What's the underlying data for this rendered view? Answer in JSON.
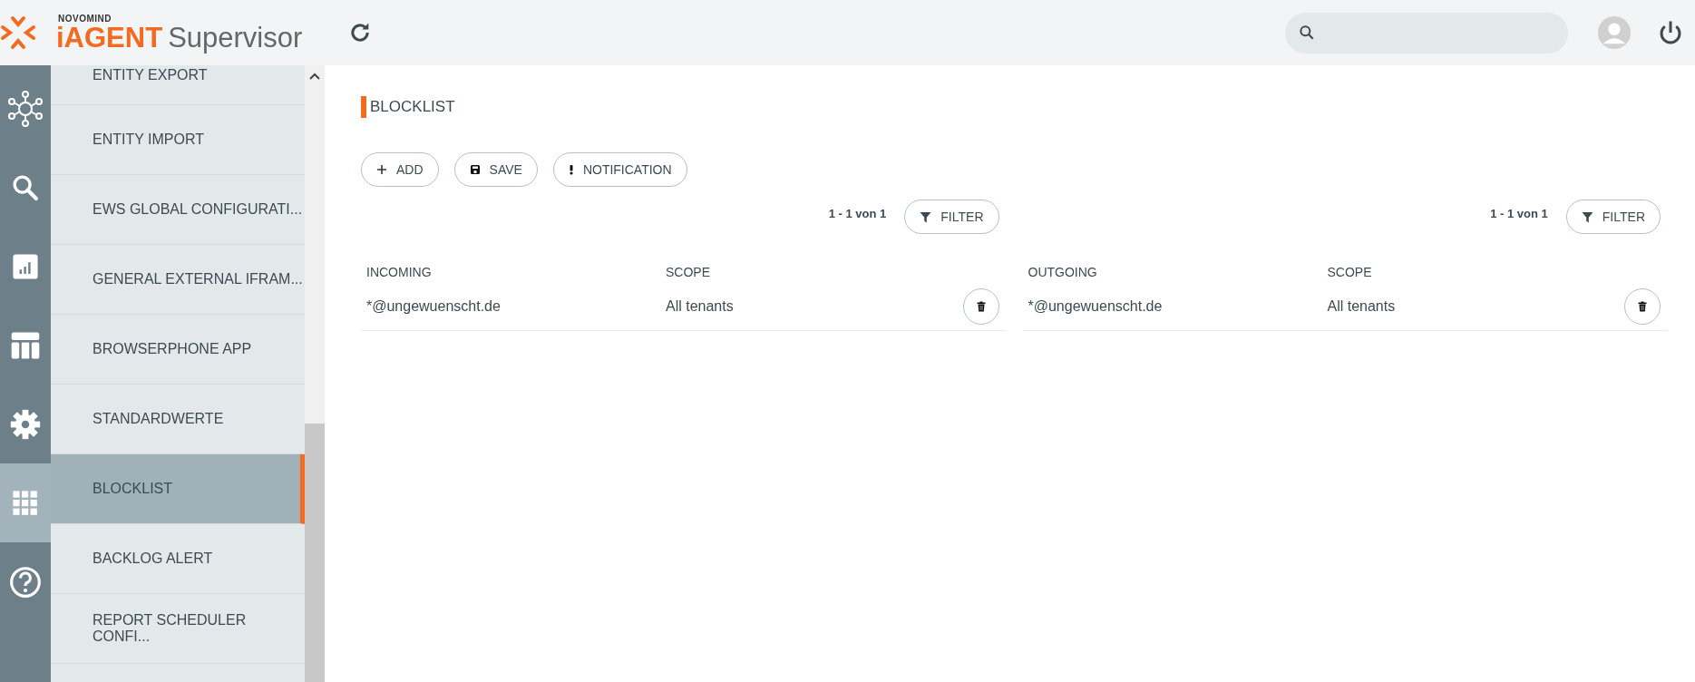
{
  "header": {
    "brand": "NOVOMIND",
    "product": "iAGENT",
    "product_suffix": "Supervisor"
  },
  "rail": [
    {
      "kind": "hub",
      "selected": false
    },
    {
      "kind": "search",
      "selected": false
    },
    {
      "kind": "chart",
      "selected": false
    },
    {
      "kind": "table",
      "selected": false
    },
    {
      "kind": "gear",
      "selected": false
    },
    {
      "kind": "grid",
      "selected": true
    },
    {
      "kind": "help",
      "selected": false
    }
  ],
  "menu": [
    {
      "label": "ENTITY EXPORT",
      "selected": false
    },
    {
      "label": "ENTITY IMPORT",
      "selected": false
    },
    {
      "label": "EWS GLOBAL CONFIGURATI...",
      "selected": false
    },
    {
      "label": "GENERAL EXTERNAL IFRAM...",
      "selected": false
    },
    {
      "label": "BROWSERPHONE APP",
      "selected": false
    },
    {
      "label": "STANDARDWERTE",
      "selected": false
    },
    {
      "label": "BLOCKLIST",
      "selected": true
    },
    {
      "label": "BACKLOG ALERT",
      "selected": false
    },
    {
      "label": "REPORT SCHEDULER CONFI...",
      "selected": false
    }
  ],
  "page_title": "BLOCKLIST",
  "toolbar": [
    {
      "label": "ADD",
      "kind": "add"
    },
    {
      "label": "SAVE",
      "kind": "save"
    },
    {
      "label": "NOTIFICATION",
      "kind": "notification"
    }
  ],
  "tables": [
    {
      "pager": "1 - 1 von 1",
      "filter": "FILTER",
      "columns": [
        "INCOMING",
        "SCOPE"
      ],
      "rows": [
        {
          "cells": [
            "*@ungewuenscht.de",
            "All tenants"
          ]
        }
      ]
    },
    {
      "pager": "1 - 1 von 1",
      "filter": "FILTER",
      "columns": [
        "OUTGOING",
        "SCOPE"
      ],
      "rows": [
        {
          "cells": [
            "*@ungewuenscht.de",
            "All tenants"
          ]
        }
      ]
    }
  ]
}
